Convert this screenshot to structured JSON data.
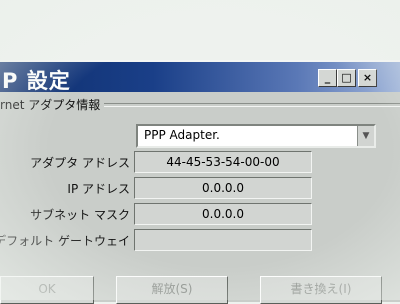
{
  "window": {
    "title": "P 設定",
    "controls": {
      "minimize": "_",
      "maximize": "□",
      "close": "×"
    }
  },
  "group": {
    "label": "rnet アダプタ情報"
  },
  "adapter_select": {
    "value": "PPP Adapter."
  },
  "fields": [
    {
      "label": "アダプタ アドレス",
      "value": "44-45-53-54-00-00"
    },
    {
      "label": "IP アドレス",
      "value": "0.0.0.0"
    },
    {
      "label": "サブネット マスク",
      "value": "0.0.0.0"
    },
    {
      "label": "デフォルト ゲートウェイ",
      "value": ""
    }
  ],
  "buttons": {
    "ok": "OK",
    "release": "解放(S)",
    "renew": "書き換え(I)"
  },
  "icons": {
    "combo_arrow": "chevron-down-icon"
  }
}
